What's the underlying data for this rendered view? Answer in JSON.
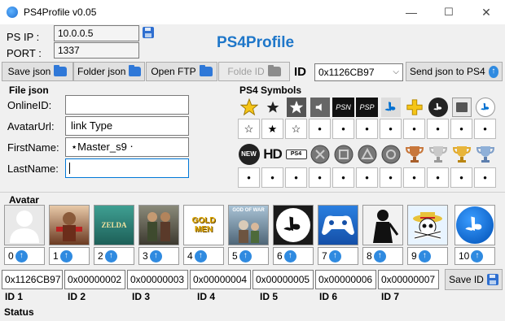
{
  "window": {
    "title": "PS4Profile v0.05",
    "minimize": "—",
    "maximize": "☐",
    "close": "✕"
  },
  "connection": {
    "ip_label": "PS IP  :",
    "ip_value": "10.0.0.5",
    "port_label": "PORT  :",
    "port_value": "1337"
  },
  "brand": "PS4Profile",
  "toolbar": {
    "save_json": "Save json",
    "folder_json": "Folder json",
    "open_ftp": "Open FTP",
    "folder_id": "Folde ID",
    "id_label": "ID",
    "id_value": "0x1126CB97",
    "send_json": "Send json to PS4"
  },
  "file_json": {
    "title": "File json",
    "fields": [
      {
        "label": "OnlineID:",
        "value": ""
      },
      {
        "label": "AvatarUrl:",
        "value": "link Type"
      },
      {
        "label": "FirstName:",
        "value": "⋆Master_s9 ⋅"
      },
      {
        "label": "LastName:",
        "value": ""
      }
    ]
  },
  "ps4_symbols": {
    "title": "PS4 Symbols",
    "row1_icons": [
      "gold-star-icon",
      "black-star-icon",
      "white-star-box-icon",
      "speaker-icon",
      "psn-logo-icon",
      "psp-logo-icon",
      "playstation-logo-icon",
      "ps-plus-icon",
      "ps-circle-logo-icon",
      "ps-store-icon",
      "ps-circle-white-icon"
    ],
    "row1_values": [
      "☆",
      "★",
      "☆",
      "•",
      "•",
      "•",
      "•",
      "•",
      "•",
      "•",
      "•"
    ],
    "row2_icons": [
      "new-badge-icon",
      "hd-badge-icon",
      "ps4-badge-icon",
      "cross-button-icon",
      "square-button-icon",
      "triangle-button-icon",
      "circle-button-icon",
      "bronze-trophy-icon",
      "silver-trophy-icon",
      "gold-trophy-icon",
      "platinum-trophy-icon"
    ],
    "row2_text": {
      "new": "NEW",
      "hd": "HD",
      "ps4": "PS4",
      "psn": "PSN",
      "psp": "PSP"
    },
    "row2_values": [
      "•",
      "•",
      "•",
      "•",
      "•",
      "•",
      "•",
      "•",
      "•",
      "•",
      "•"
    ]
  },
  "avatar": {
    "title": "Avatar",
    "items": [
      {
        "index": "0",
        "icon": "default-user-avatar-icon"
      },
      {
        "index": "1",
        "icon": "fighter-avatar-icon"
      },
      {
        "index": "2",
        "icon": "zelda-logo-icon",
        "label": "ZELDA"
      },
      {
        "index": "3",
        "icon": "soldiers-avatar-icon"
      },
      {
        "index": "4",
        "icon": "gold-men-logo-icon",
        "label": "GOLD MEN"
      },
      {
        "index": "5",
        "icon": "god-of-war-avatar-icon",
        "label": "GOD OF WAR"
      },
      {
        "index": "6",
        "icon": "playstation-dark-logo-icon"
      },
      {
        "index": "7",
        "icon": "controller-avatar-icon"
      },
      {
        "index": "8",
        "icon": "ninja-avatar-icon"
      },
      {
        "index": "9",
        "icon": "one-piece-skull-icon"
      },
      {
        "index": "10",
        "icon": "playstation-blue-logo-icon"
      }
    ]
  },
  "ids": {
    "values": [
      "0x1126CB97",
      "0x00000002",
      "0x00000003",
      "0x00000004",
      "0x00000005",
      "0x00000006",
      "0x00000007"
    ],
    "labels": [
      "ID 1",
      "ID 2",
      "ID 3",
      "ID 4",
      "ID 5",
      "ID 6",
      "ID 7"
    ],
    "save_label": "Save ID"
  },
  "status": "Status",
  "colors": {
    "accent": "#1f77c9",
    "button_blue": "#2f8ae0",
    "folder_blue": "#2f78d8",
    "ps_blue": "#0070d1"
  }
}
